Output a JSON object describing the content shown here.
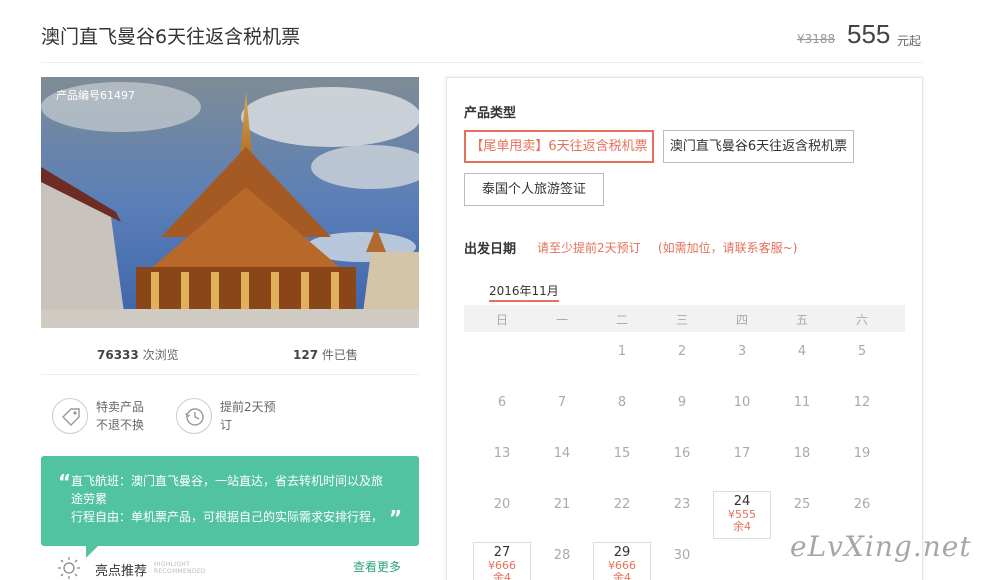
{
  "header": {
    "title": "澳门直飞曼谷6天往返含税机票",
    "price_original": "¥3188",
    "price_current": "555",
    "price_unit": "元起"
  },
  "product": {
    "code": "产品编号61497",
    "views_count": "76333",
    "views_label": "次浏览",
    "sold_count": "127",
    "sold_label": "件已售"
  },
  "features": [
    {
      "icon": "tag-icon",
      "line1": "特卖产品",
      "line2": "不退不换"
    },
    {
      "icon": "clock-history-icon",
      "line1": "提前2天预",
      "line2": "订"
    }
  ],
  "intro": {
    "line1": "直飞航班：澳门直飞曼谷，一站直达，省去转机时间以及旅途劳累",
    "line2": "行程自由：单机票产品，可根据自己的实际需求安排行程，"
  },
  "highlight": {
    "title": "亮点推荐",
    "en_line1": "HIGHLIGHT",
    "en_line2": "RECOMMENDED",
    "more": "查看更多",
    "icon": "sun-icon"
  },
  "booking": {
    "type_label": "产品类型",
    "options": [
      "【尾单甩卖】6天往返含税机票",
      "澳门直飞曼谷6天往返含税机票",
      "泰国个人旅游签证"
    ],
    "selected_index": 0,
    "date_label": "出发日期",
    "hint1": "请至少提前2天预订",
    "hint2": "(如需加位，请联系客服~)",
    "month": "2016年11月",
    "weekdays": [
      "日",
      "一",
      "二",
      "三",
      "四",
      "五",
      "六"
    ],
    "rows": [
      [
        "",
        "",
        "1",
        "2",
        "3",
        "4",
        "5"
      ],
      [
        "6",
        "7",
        "8",
        "9",
        "10",
        "11",
        "12"
      ],
      [
        "13",
        "14",
        "15",
        "16",
        "17",
        "18",
        "19"
      ],
      [
        "20",
        "21",
        "22",
        "23",
        "24",
        "25",
        "26"
      ],
      [
        "27",
        "28",
        "29",
        "30",
        "",
        "",
        ""
      ]
    ],
    "available": {
      "24": {
        "price": "¥555",
        "remain": "余4"
      },
      "27": {
        "price": "¥666",
        "remain": "余4"
      },
      "29": {
        "price": "¥666",
        "remain": "余4"
      }
    }
  },
  "watermark": "eLvXing.net"
}
